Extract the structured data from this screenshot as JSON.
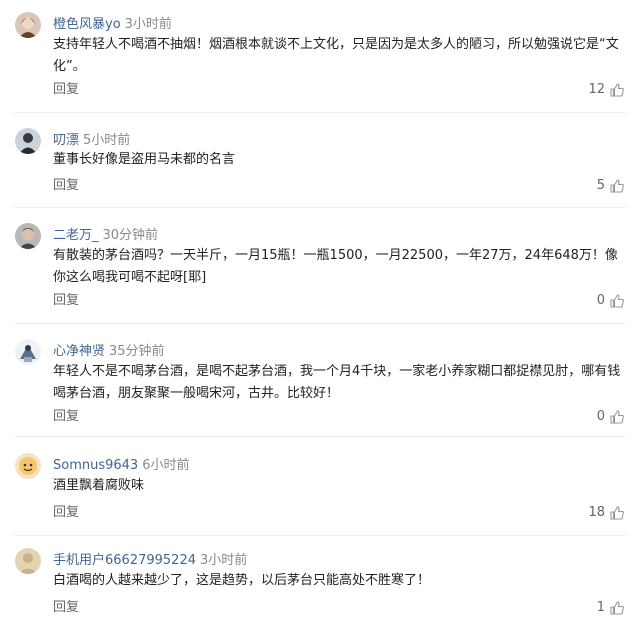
{
  "reply_label": "回复",
  "comments": [
    {
      "username": "橙色风暴yo",
      "time": "3小时前",
      "text": "支持年轻人不喝酒不抽烟！烟酒根本就谈不上文化，只是因为是太多人的陋习，所以勉强说它是“文化”。",
      "likes": "12",
      "avatar": "woman-portrait"
    },
    {
      "username": "叨漂",
      "time": "5小时前",
      "text": "董事长好像是盗用马未都的名言",
      "likes": "5",
      "avatar": "person-silhouette"
    },
    {
      "username": "二老万_",
      "time": "30分钟前",
      "text": "有散装的茅台酒吗？一天半斤，一月15瓶！一瓶1500，一月22500，一年27万，24年648万！像你这么喝我可喝不起呀[耶]",
      "likes": "0",
      "avatar": "man-portrait"
    },
    {
      "username": "心净神贤",
      "time": "35分钟前",
      "text": "年轻人不是不喝茅台酒，是喝不起茅台酒，我一个月4千块，一家老小养家糊口都捉襟见肘，哪有钱喝茅台酒，朋友聚聚一般喝宋河，古井。比较好！",
      "likes": "0",
      "avatar": "cartoon-figure"
    },
    {
      "username": "Somnus9643",
      "time": "6小时前",
      "text": "酒里飘着腐败味",
      "likes": "18",
      "avatar": "cartoon-face"
    },
    {
      "username": "手机用户66627995224",
      "time": "3小时前",
      "text": "白酒喝的人越来越少了，这是趋势，以后茅台只能高处不胜寒了！",
      "likes": "1",
      "avatar": "default-avatar"
    }
  ]
}
